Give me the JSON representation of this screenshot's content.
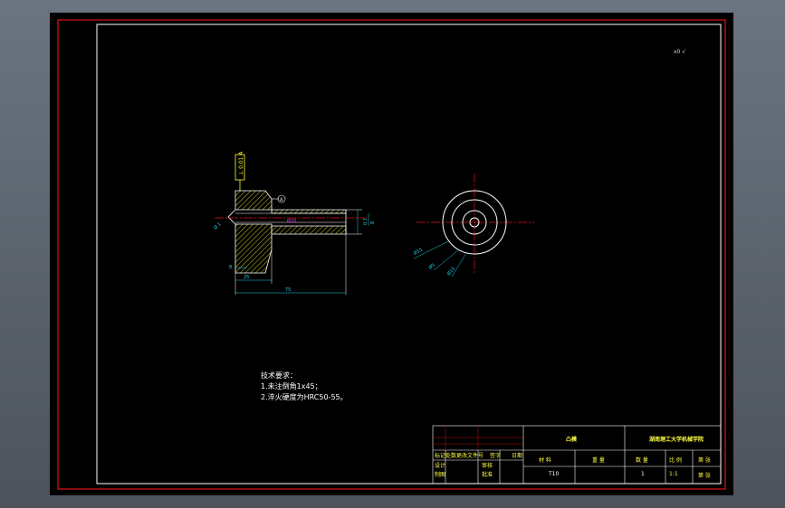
{
  "drawing": {
    "corner_note": "x0 √",
    "dims": {
      "d1": "25",
      "d2": "75",
      "d3": "20",
      "d4": "8",
      "d5": "Ø 1",
      "d6": "0.1",
      "d7": "Ø10",
      "d8": "Ø5",
      "d9": "Ø15",
      "d10": "Ø20"
    },
    "gdt": "⊥ 0.01 A",
    "datum": "A"
  },
  "notes": {
    "title": "技术要求：",
    "line1": "1.未注倒角1x45；",
    "line2": "2.淬火硬度为HRC50-55。"
  },
  "title_block": {
    "part_name": "凸模",
    "school": "湖南理工大学机械学院",
    "material_label": "材 料",
    "material": "T10",
    "qty_label": "数 量",
    "qty": "1",
    "scale_label": "比 例",
    "scale": "1:1",
    "sheet_label": "第 张",
    "weight_label": "重 量",
    "r1": "标记处数",
    "r1b": "更改文件号",
    "r1c": "签字",
    "r1d": "日期",
    "r2a": "设计",
    "r2b": "审核",
    "r3a": "制图",
    "r3b": "批准"
  },
  "colors": {
    "border_red": "#e01515",
    "cyan": "#22d4e8",
    "yellow": "#ffff30",
    "magenta": "#e83cf0",
    "white": "#ffffff"
  }
}
